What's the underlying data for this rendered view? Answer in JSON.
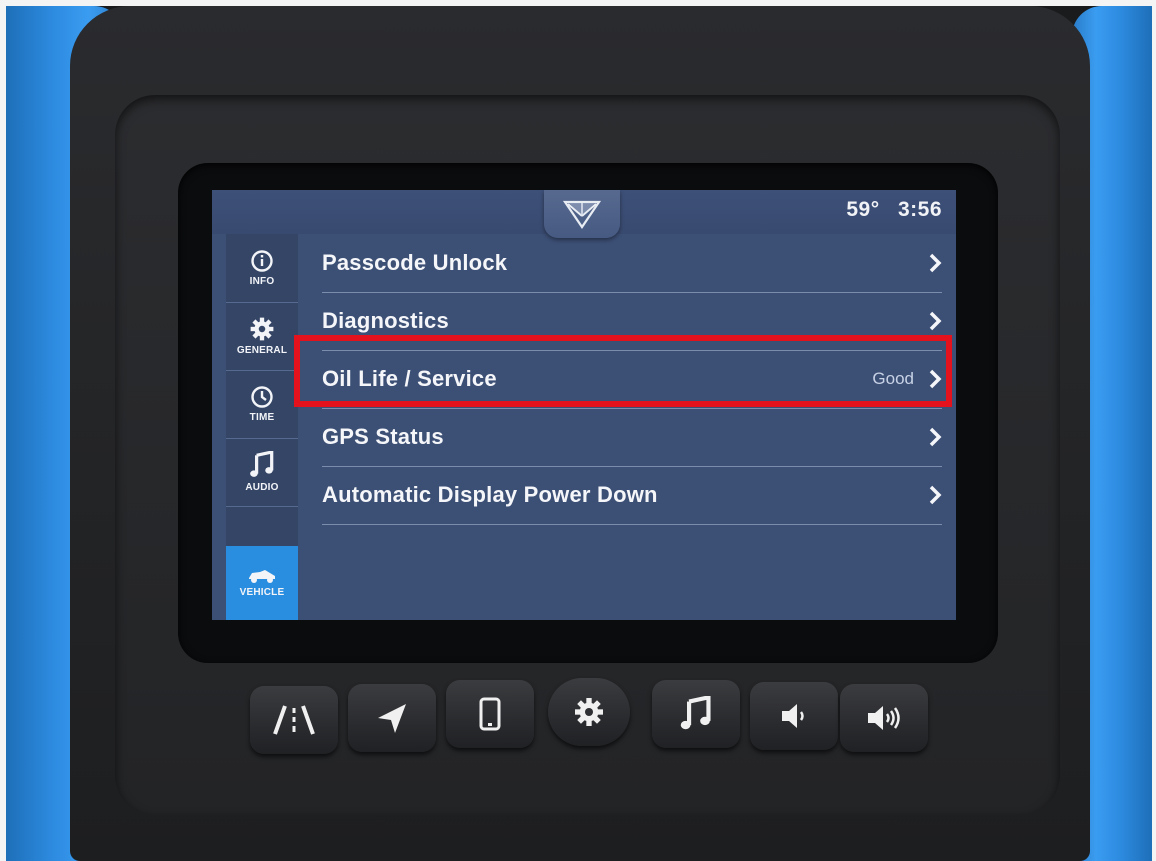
{
  "status": {
    "temperature": "59°",
    "time": "3:56"
  },
  "sidebar": {
    "items": [
      {
        "label": "INFO",
        "icon": "info-icon"
      },
      {
        "label": "GENERAL",
        "icon": "gear-icon"
      },
      {
        "label": "TIME",
        "icon": "clock-icon"
      },
      {
        "label": "AUDIO",
        "icon": "music-note-icon"
      },
      {
        "label": "VEHICLE",
        "icon": "vehicle-icon",
        "active": true
      }
    ]
  },
  "menu": {
    "items": [
      {
        "title": "Passcode Unlock",
        "value": ""
      },
      {
        "title": "Diagnostics",
        "value": ""
      },
      {
        "title": "Oil Life / Service",
        "value": "Good"
      },
      {
        "title": "GPS Status",
        "value": ""
      },
      {
        "title": "Automatic Display Power Down",
        "value": ""
      }
    ]
  },
  "hardware_buttons": [
    "road-icon",
    "navigation-arrow-icon",
    "phone-icon",
    "settings-gear-icon",
    "music-note-icon",
    "volume-down-icon",
    "volume-up-icon"
  ],
  "colors": {
    "screen_bg": "#3c4f75",
    "active_tab": "#2a8ee0",
    "highlight": "#e3121c",
    "housing_blue": "#2d8be0"
  }
}
